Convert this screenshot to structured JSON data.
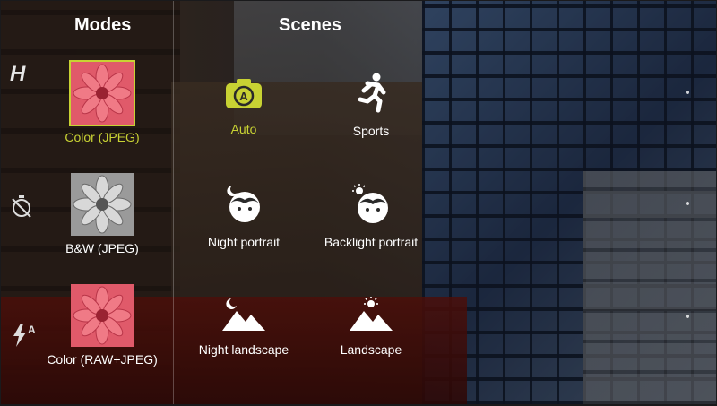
{
  "colors": {
    "accent": "#c8d233",
    "text": "#ffffff"
  },
  "modes": {
    "heading": "Modes",
    "items": [
      {
        "label": "Color (JPEG)",
        "selected": true,
        "style": "color"
      },
      {
        "label": "B&W (JPEG)",
        "selected": false,
        "style": "bw"
      },
      {
        "label": "Color (RAW+JPEG)",
        "selected": false,
        "style": "color"
      }
    ]
  },
  "scenes": {
    "heading": "Scenes",
    "items": [
      {
        "label": "Auto",
        "icon": "auto-icon",
        "selected": true
      },
      {
        "label": "Sports",
        "icon": "running-person-icon",
        "selected": false
      },
      {
        "label": "Night portrait",
        "icon": "night-portrait-icon",
        "selected": false
      },
      {
        "label": "Backlight portrait",
        "icon": "backlight-portrait-icon",
        "selected": false
      },
      {
        "label": "Night landscape",
        "icon": "night-landscape-icon",
        "selected": false
      },
      {
        "label": "Landscape",
        "icon": "landscape-icon",
        "selected": false
      }
    ]
  },
  "side_icons": {
    "top": "hdr-icon",
    "middle": "timer-off-icon",
    "bottom_symbol": "A"
  }
}
